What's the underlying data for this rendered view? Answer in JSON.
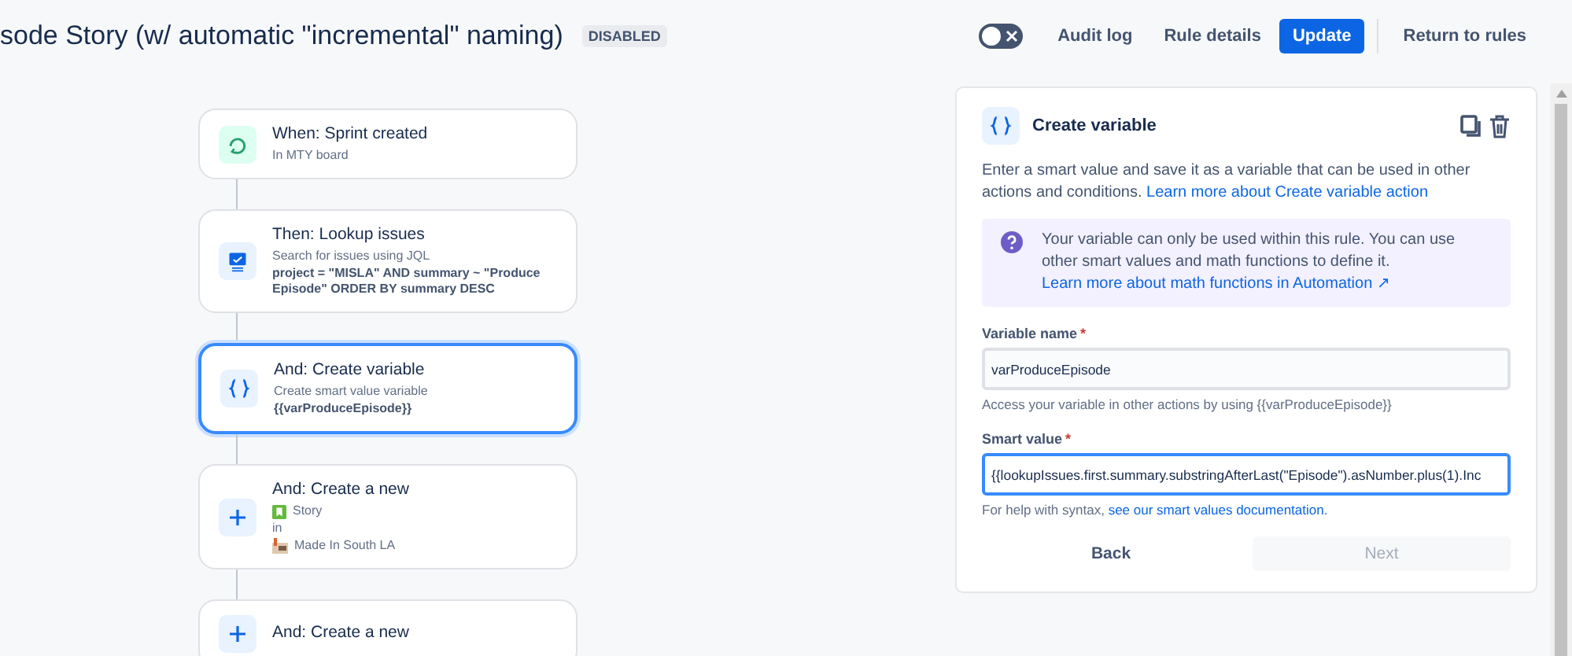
{
  "header": {
    "title": "sode Story (w/ automatic \"incremental\" naming)",
    "status_badge": "DISABLED",
    "rule_enabled": {
      "on": false
    },
    "actions": [
      {
        "label": "Audit log",
        "kind": "subtle"
      },
      {
        "label": "Rule details",
        "kind": "subtle"
      },
      {
        "label": "Update",
        "kind": "primary"
      },
      {
        "label": "Return to rules",
        "kind": "subtle"
      }
    ]
  },
  "steps": [
    {
      "kind": "trigger",
      "title": "When: Sprint created",
      "selected": false,
      "lines": [
        {
          "kind": "plain",
          "text": "In MTY board"
        }
      ]
    },
    {
      "kind": "lookup",
      "title": "Then: Lookup issues",
      "selected": false,
      "lines": [
        {
          "kind": "plain",
          "text": "Search for issues using JQL"
        },
        {
          "kind": "code",
          "text": "project = \"MISLA\" AND summary ~ \"Produce Episode\" ORDER BY summary DESC"
        }
      ]
    },
    {
      "kind": "variable",
      "title": "And: Create variable",
      "selected": true,
      "lines": [
        {
          "kind": "plain",
          "text": "Create smart value variable"
        },
        {
          "kind": "code",
          "text": "{{varProduceEpisode}}"
        }
      ]
    },
    {
      "kind": "create",
      "title": "And: Create a new",
      "selected": false,
      "lines": [
        {
          "kind": "issue-type",
          "text": "Story"
        },
        {
          "kind": "plain",
          "text": "in"
        },
        {
          "kind": "project",
          "text": "Made In South LA"
        }
      ]
    },
    {
      "kind": "create",
      "title": "And: Create a new",
      "selected": false
    }
  ],
  "panel": {
    "title": "Create variable",
    "description": "Enter a smart value and save it as a variable that can be used in other actions and conditions.",
    "description_link": "Learn more about Create variable action",
    "info": {
      "text": "Your variable can only be used within this rule. You can use other smart values and math functions to define it.",
      "link": "Learn more about math functions in Automation ↗"
    },
    "fields": [
      {
        "label": "Variable name",
        "required_mark": "*",
        "value": "varProduceEpisode",
        "focused": false,
        "help": "Access your variable in other actions by using {{varProduceEpisode}}"
      },
      {
        "label": "Smart value",
        "required_mark": "*",
        "value": "{{lookupIssues.first.summary.substringAfterLast(\"Episode\").asNumber.plus(1).Inc",
        "focused": true,
        "help": "For help with syntax,",
        "help_link": "see our smart values documentation."
      }
    ],
    "buttons": [
      {
        "label": "Back",
        "disabled": false
      },
      {
        "label": "Next",
        "disabled": true
      }
    ]
  }
}
